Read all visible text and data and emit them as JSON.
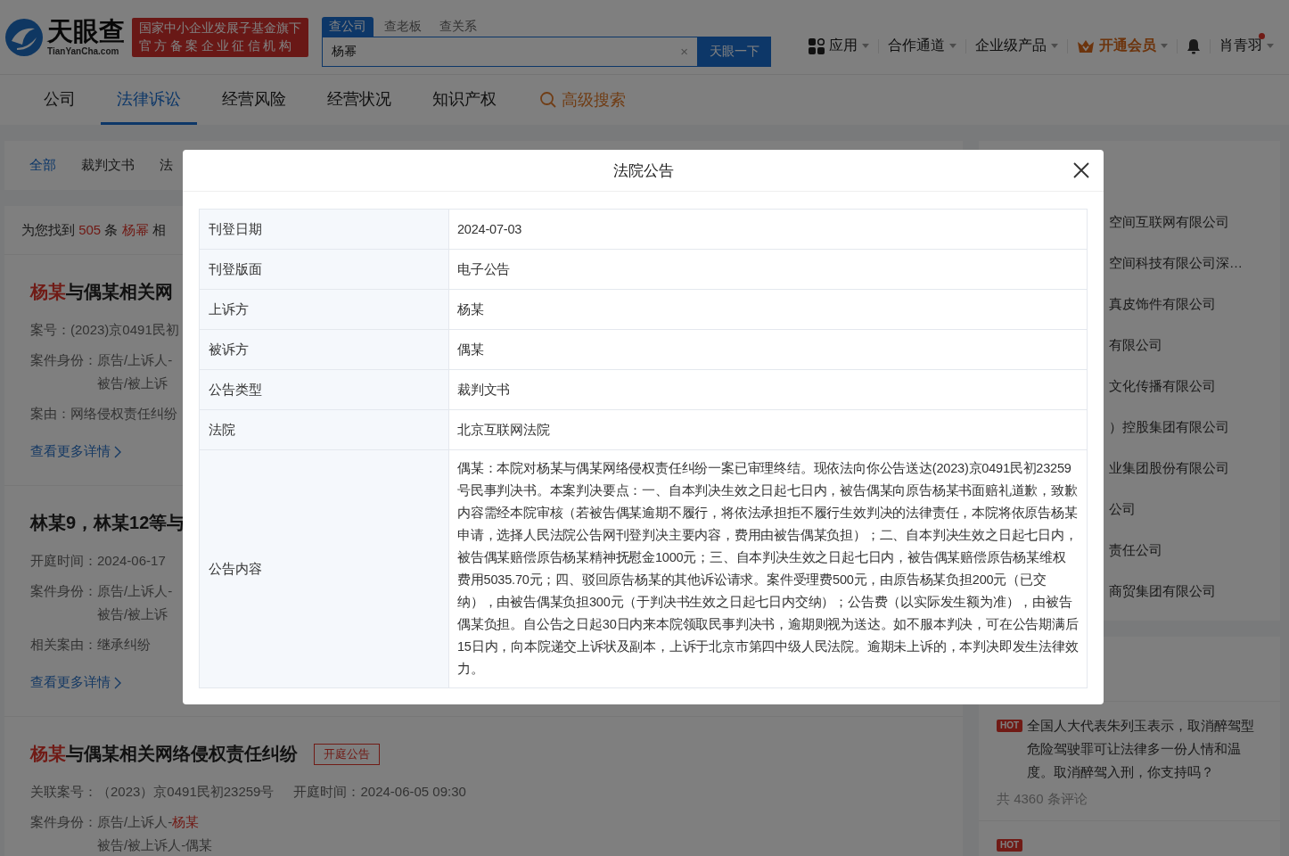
{
  "header": {
    "logo": {
      "name": "天眼查",
      "domain": "TianYanCha.com"
    },
    "badge_lines": [
      "国家中小企业发展子基金旗下",
      "官方备案企业征信机构"
    ],
    "search": {
      "tabs": [
        {
          "label": "查公司",
          "selected": true
        },
        {
          "label": "查老板",
          "selected": false
        },
        {
          "label": "查关系",
          "selected": false
        }
      ],
      "value": "杨幂",
      "clear": "×",
      "button": "天眼一下"
    },
    "menu": [
      {
        "label": "应用",
        "kind": "apps"
      },
      {
        "label": "合作通道",
        "kind": "plain"
      },
      {
        "label": "企业级产品",
        "kind": "plain"
      },
      {
        "label": "开通会员",
        "kind": "vip"
      }
    ],
    "user": {
      "name": "肖青羽",
      "unread": true
    }
  },
  "nav_tabs": [
    {
      "label": "公司",
      "selected": false
    },
    {
      "label": "法律诉讼",
      "selected": true
    },
    {
      "label": "经营风险",
      "selected": false
    },
    {
      "label": "经营状况",
      "selected": false
    },
    {
      "label": "知识产权",
      "selected": false
    }
  ],
  "advanced_search": "高级搜索",
  "filter_tabs": [
    {
      "label": "全部",
      "selected": true
    },
    {
      "label": "裁判文书",
      "selected": false
    },
    {
      "label": "法",
      "selected": false
    }
  ],
  "result_summary": {
    "prefix": "为您找到",
    "count": "505",
    "unit": "条",
    "keyword": "杨幂",
    "suffix": "相"
  },
  "results": [
    {
      "title": {
        "highlight": "杨某",
        "text": "与偶某相关网"
      },
      "rows": [
        [
          {
            "label": "案号：",
            "lines": [
              {
                "text": "(2023)京0491民初"
              }
            ]
          }
        ],
        [
          {
            "label": "案件身份：",
            "lines": [
              {
                "text": "原告/上诉人-"
              },
              {
                "text": "被告/被上诉"
              }
            ]
          }
        ],
        [
          {
            "label": "案由：",
            "lines": [
              {
                "text": "网络侵权责任纠纷"
              }
            ]
          }
        ]
      ],
      "more": "查看更多详情"
    },
    {
      "title": {
        "text": "林某9，林某12等与"
      },
      "rows": [
        [
          {
            "label": "开庭时间：",
            "lines": [
              {
                "text": "2024-06-17"
              }
            ]
          }
        ],
        [
          {
            "label": "案件身份：",
            "lines": [
              {
                "text": "原告/上诉人-"
              },
              {
                "text": "被告/被上诉"
              }
            ]
          }
        ],
        [
          {
            "label": "相关案由：",
            "lines": [
              {
                "text": "继承纠纷"
              }
            ]
          }
        ]
      ],
      "more": "查看更多详情"
    },
    {
      "title": {
        "highlight": "杨某",
        "text": "与偶某相关网络侵权责任纠纷"
      },
      "tag": "开庭公告",
      "rows": [
        [
          {
            "label": "关联案号：",
            "lines": [
              {
                "text": "（2023）京0491民初23259号"
              }
            ]
          },
          {
            "label": "开庭时间：",
            "lines": [
              {
                "text": "2024-06-05 09:30"
              }
            ]
          }
        ],
        [
          {
            "label": "案件身份：",
            "lines": [
              {
                "text": "原告/上诉人-",
                "highlight": "杨某"
              },
              {
                "text": "被告/被上诉人-偶某"
              }
            ]
          }
        ]
      ]
    }
  ],
  "sidebar": {
    "companies": [
      "空间互联网有限公司",
      "空间科技有限公司深…",
      "真皮饰件有限公司",
      "有限公司",
      "文化传播有限公司",
      "）控股集团有限公司",
      "业集团股份有限公司",
      "公司",
      "责任公司",
      "商贸集团有限公司"
    ],
    "hot": [
      {
        "badge": "HOT",
        "text": "全国人大代表朱列玉表示，取消醉驾型危险驾驶罪可让法律多一份人情和温度。取消醉驾入刑，你支持吗？",
        "comments": "共 4360 条评论"
      },
      {
        "badge": "HOT"
      }
    ]
  },
  "dialog": {
    "title": "法院公告",
    "rows": [
      {
        "label": "刊登日期",
        "value": "2024-07-03"
      },
      {
        "label": "刊登版面",
        "value": "电子公告"
      },
      {
        "label": "上诉方",
        "value": "杨某"
      },
      {
        "label": "被诉方",
        "value": "偶某"
      },
      {
        "label": "公告类型",
        "value": "裁判文书"
      },
      {
        "label": "法院",
        "value": "北京互联网法院"
      },
      {
        "label": "公告内容",
        "value": "偶某：本院对杨某与偶某网络侵权责任纠纷一案已审理终结。现依法向你公告送达(2023)京0491民初23259号民事判决书。本案判决要点：一、自本判决生效之日起七日内，被告偶某向原告杨某书面赔礼道歉，致歉内容需经本院审核（若被告偶某逾期不履行，将依法承担拒不履行生效判决的法律责任，本院将依原告杨某申请，选择人民法院公告网刊登判决主要内容，费用由被告偶某负担）；二、自本判决生效之日起七日内，被告偶某赔偿原告杨某精神抚慰金1000元；三、自本判决生效之日起七日内，被告偶某赔偿原告杨某维权费用5035.70元；四、驳回原告杨某的其他诉讼请求。案件受理费500元，由原告杨某负担200元（已交纳），由被告偶某负担300元（于判决书生效之日起七日内交纳）；公告费（以实际发生额为准），由被告偶某负担。自公告之日起30日内来本院领取民事判决书，逾期则视为送达。如不服本判决，可在公告期满后15日内，向本院递交上诉状及副本，上诉于北京市第四中级人民法院。逾期未上诉的，本判决即发生法律效力。"
      }
    ]
  }
}
